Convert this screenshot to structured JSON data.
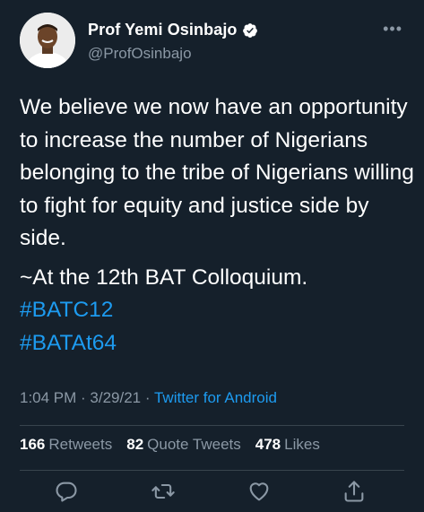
{
  "author": {
    "name": "Prof Yemi Osinbajo",
    "handle": "@ProfOsinbajo",
    "verified_icon": "verified-badge-icon"
  },
  "tweet": {
    "paragraph1": "We believe we now have an opportunity to increase the number of Nigerians belonging to the tribe of Nigerians willing to fight for equity and justice side by side.",
    "paragraph2": "~At the 12th BAT Colloquium.",
    "hashtags": [
      "#BATC12",
      "#BATAt64"
    ]
  },
  "meta": {
    "time": "1:04 PM",
    "separator1": " · ",
    "date": "3/29/21",
    "separator2": " · ",
    "source": "Twitter for Android"
  },
  "stats": {
    "retweets_count": "166",
    "retweets_label": "Retweets",
    "quotes_count": "82",
    "quotes_label": "Quote Tweets",
    "likes_count": "478",
    "likes_label": "Likes"
  },
  "colors": {
    "background": "#15202b",
    "accent": "#1d9bf0",
    "secondary_text": "#8b98a5"
  }
}
